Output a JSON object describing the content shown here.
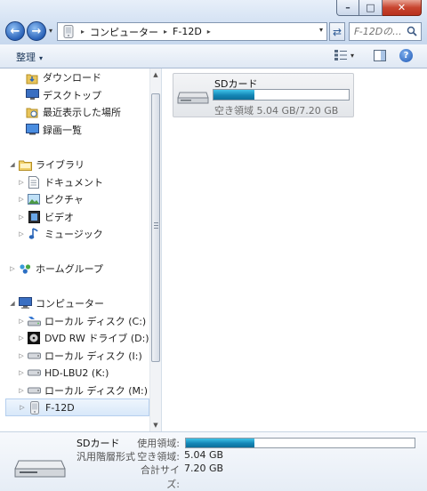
{
  "window": {
    "controls": {
      "minimize": "–",
      "maximize": "□",
      "close": "✕"
    }
  },
  "nav": {
    "back_glyph": "←",
    "forward_glyph": "→",
    "recent_glyph": "▾"
  },
  "address": {
    "crumbs": [
      "コンピューター",
      "F-12D"
    ],
    "separator": "▸",
    "dropdown_glyph": "▾",
    "refresh_glyph": "⇄"
  },
  "search": {
    "placeholder": "F-12Dの..."
  },
  "toolbar": {
    "organize": "整理",
    "caret": "▾",
    "help": "?"
  },
  "tree": {
    "expand_glyph": "▷",
    "expanded_glyph": "◢",
    "items": [
      {
        "label": "ダウンロード",
        "icon": "downloads-icon"
      },
      {
        "label": "デスクトップ",
        "icon": "desktop-icon"
      },
      {
        "label": "最近表示した場所",
        "icon": "recent-places-icon"
      },
      {
        "label": "録画一覧",
        "icon": "recorded-tv-icon"
      },
      {
        "label": "ライブラリ",
        "icon": "libraries-icon"
      },
      {
        "label": "ドキュメント",
        "icon": "documents-icon"
      },
      {
        "label": "ピクチャ",
        "icon": "pictures-icon"
      },
      {
        "label": "ビデオ",
        "icon": "videos-icon"
      },
      {
        "label": "ミュージック",
        "icon": "music-icon"
      },
      {
        "label": "ホームグループ",
        "icon": "homegroup-icon"
      },
      {
        "label": "コンピューター",
        "icon": "computer-icon"
      },
      {
        "label": "ローカル ディスク (C:)",
        "icon": "local-disk-icon"
      },
      {
        "label": "DVD RW ドライブ (D:) EX",
        "icon": "dvd-drive-icon"
      },
      {
        "label": "ローカル ディスク (I:)",
        "icon": "drive-icon"
      },
      {
        "label": "HD-LBU2 (K:)",
        "icon": "drive-icon"
      },
      {
        "label": "ローカル ディスク (M:)",
        "icon": "drive-icon"
      },
      {
        "label": "F-12D",
        "icon": "phone-device-icon"
      }
    ]
  },
  "scroll": {
    "up": "▲",
    "down": "▼"
  },
  "drive": {
    "name": "SDカード",
    "space_text": "空き領域 5.04 GB/7.20 GB",
    "used_fraction": 0.3,
    "icon": "removable-drive-icon"
  },
  "details": {
    "name": "SDカード",
    "type": "汎用階層形式",
    "used_label": "使用領域:",
    "free_label": "空き領域:",
    "free_value": "5.04 GB",
    "total_label": "合計サイズ:",
    "total_value": "7.20 GB",
    "used_fraction": 0.3
  },
  "colors": {
    "accent": "#1486b6",
    "frame": "#c9d9ee"
  }
}
